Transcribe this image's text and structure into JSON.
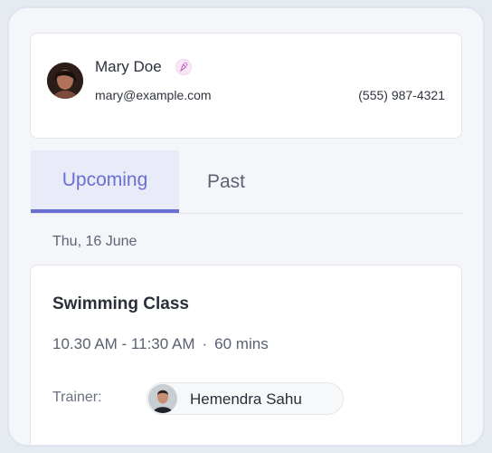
{
  "profile": {
    "name": "Mary Doe",
    "email": "mary@example.com",
    "phone": "(555) 987-4321",
    "verified_icon": "party-popper-icon"
  },
  "tabs": [
    {
      "label": "Upcoming",
      "active": true
    },
    {
      "label": "Past",
      "active": false
    }
  ],
  "schedule": {
    "date": "Thu, 16 June",
    "session": {
      "title": "Swimming Class",
      "time": "10.30 AM - 11:30 AM",
      "separator": "·",
      "duration": "60 mins",
      "trainer_label": "Trainer:",
      "trainer_name": "Hemendra Sahu"
    }
  },
  "colors": {
    "accent": "#6a6fd2",
    "tab_active_bg": "#e9ebf8"
  }
}
